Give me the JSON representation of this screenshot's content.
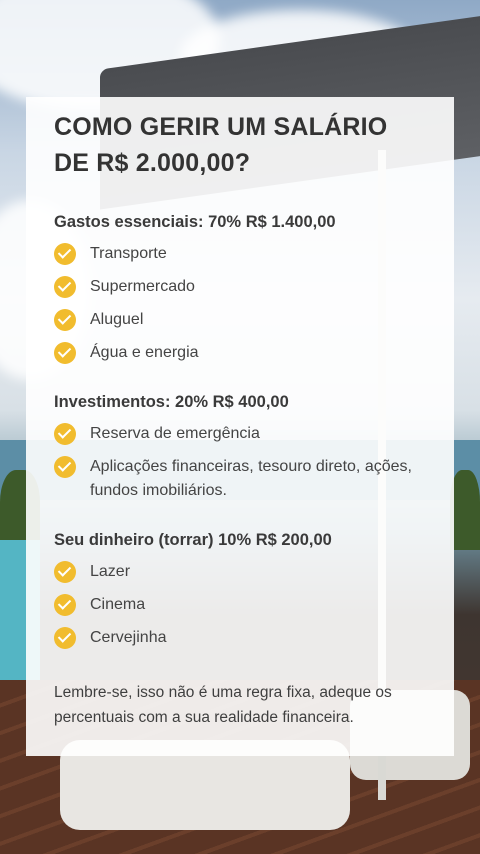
{
  "title": "COMO GERIR UM SALÁRIO DE R$ 2.000,00?",
  "sections": [
    {
      "heading": "Gastos essenciais: 70% R$ 1.400,00",
      "items": [
        "Transporte",
        "Supermercado",
        "Aluguel",
        "Água e energia"
      ]
    },
    {
      "heading": "Investimentos: 20% R$ 400,00",
      "items": [
        "Reserva de emergência",
        "Aplicações financeiras, tesouro direto, ações, fundos imobiliários."
      ]
    },
    {
      "heading": "Seu dinheiro (torrar) 10% R$ 200,00",
      "items": [
        "Lazer",
        "Cinema",
        "Cervejinha"
      ]
    }
  ],
  "note": "Lembre-se, isso não é uma regra fixa, adeque os percentuais com a sua realidade financeira.",
  "icons": {
    "bullet": "check-circle-icon"
  },
  "colors": {
    "accent": "#f1bc2e",
    "card": "#ffffff"
  }
}
